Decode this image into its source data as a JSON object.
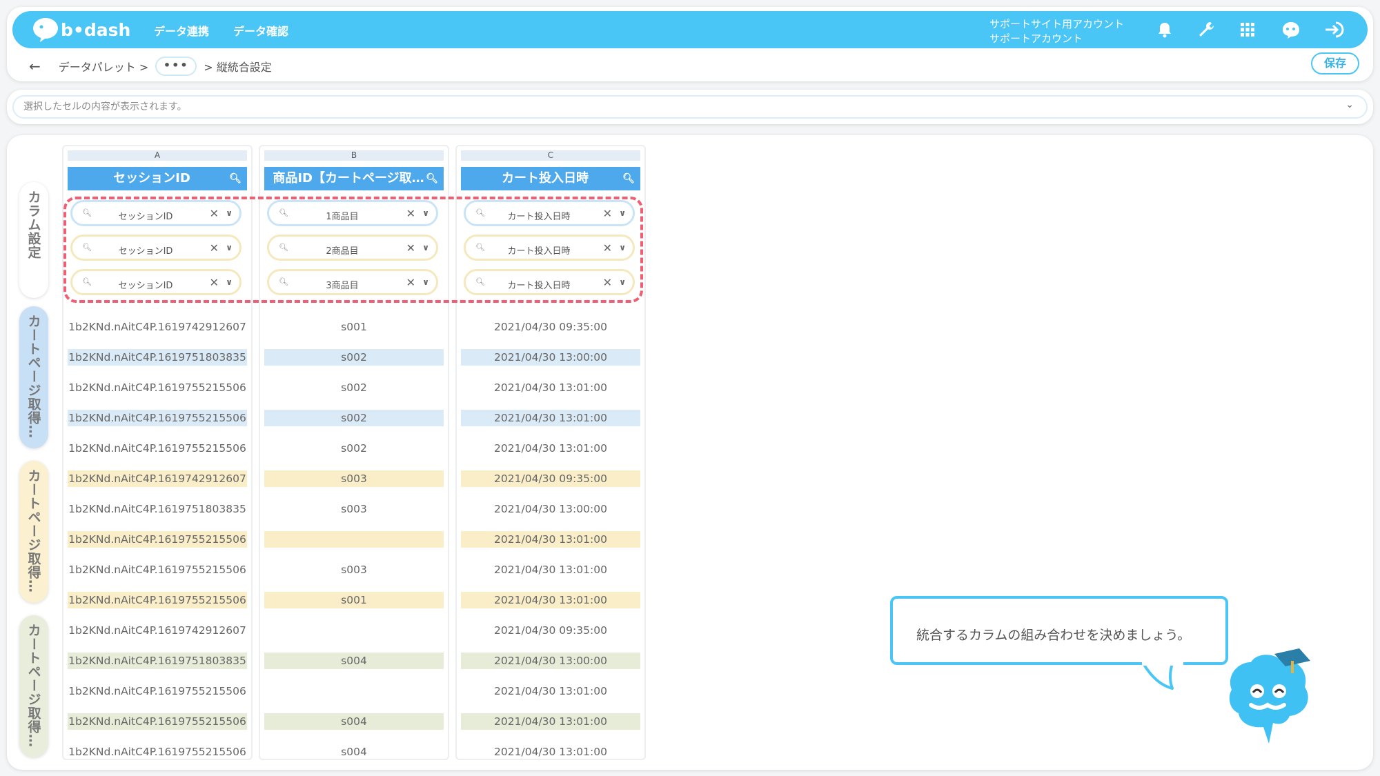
{
  "header": {
    "logo_text": "b•dash",
    "nav": [
      "データ連携",
      "データ確認"
    ],
    "account_line1": "サポートサイト用アカウント",
    "account_line2": "サポートアカウント",
    "icons": [
      "bell-icon",
      "wrench-icon",
      "grid-icon",
      "help-mascot-icon",
      "logout-icon"
    ],
    "accent_color": "#49c5f6"
  },
  "breadcrumb": {
    "back": "←",
    "item1": "データパレット >",
    "ellipsis": "•••",
    "current": "> 縦統合設定"
  },
  "save_label": "保存",
  "cell_bar": {
    "placeholder": "選択したセルの内容が表示されます。",
    "chevron": "⌄"
  },
  "side_tabs": [
    {
      "label": "カラム設定",
      "color": "#ffffff"
    },
    {
      "label": "カートページ取得…",
      "color": "#c8e0f6"
    },
    {
      "label": "カートページ取得…",
      "color": "#fbf0cf"
    },
    {
      "label": "カートページ取得…",
      "color": "#e9eedc"
    }
  ],
  "columns": [
    {
      "letter": "A",
      "header": "セッションID",
      "selectors": [
        "セッションID",
        "セッションID",
        "セッションID"
      ]
    },
    {
      "letter": "B",
      "header": "商品ID【カートページ取…",
      "selectors": [
        "1商品目",
        "2商品目",
        "3商品目"
      ]
    },
    {
      "letter": "C",
      "header": "カート投入日時",
      "selectors": [
        "カート投入日時",
        "カート投入日時",
        "カート投入日時"
      ]
    }
  ],
  "selector_border_colors": [
    "#c9e3f7",
    "#f5e8bd",
    "#f5e8bd"
  ],
  "rows": [
    {
      "a": "1b2KNd.nAitC4P.1619742912607",
      "b": "s001",
      "c": "2021/04/30 09:35:00",
      "hl": ""
    },
    {
      "a": "1b2KNd.nAitC4P.1619751803835",
      "b": "s002",
      "c": "2021/04/30 13:00:00",
      "hl": "blue"
    },
    {
      "a": "1b2KNd.nAitC4P.1619755215506",
      "b": "s002",
      "c": "2021/04/30 13:01:00",
      "hl": ""
    },
    {
      "a": "1b2KNd.nAitC4P.1619755215506",
      "b": "s002",
      "c": "2021/04/30 13:01:00",
      "hl": "blue"
    },
    {
      "a": "1b2KNd.nAitC4P.1619755215506",
      "b": "s002",
      "c": "2021/04/30 13:01:00",
      "hl": ""
    },
    {
      "a": "1b2KNd.nAitC4P.1619742912607",
      "b": "s003",
      "c": "2021/04/30 09:35:00",
      "hl": "yellow"
    },
    {
      "a": "1b2KNd.nAitC4P.1619751803835",
      "b": "s003",
      "c": "2021/04/30 13:00:00",
      "hl": ""
    },
    {
      "a": "1b2KNd.nAitC4P.1619755215506",
      "b": "",
      "c": "2021/04/30 13:01:00",
      "hl": "yellow"
    },
    {
      "a": "1b2KNd.nAitC4P.1619755215506",
      "b": "s003",
      "c": "2021/04/30 13:01:00",
      "hl": ""
    },
    {
      "a": "1b2KNd.nAitC4P.1619755215506",
      "b": "s001",
      "c": "2021/04/30 13:01:00",
      "hl": "yellow"
    },
    {
      "a": "1b2KNd.nAitC4P.1619742912607",
      "b": "",
      "c": "2021/04/30 09:35:00",
      "hl": ""
    },
    {
      "a": "1b2KNd.nAitC4P.1619751803835",
      "b": "s004",
      "c": "2021/04/30 13:00:00",
      "hl": "green"
    },
    {
      "a": "1b2KNd.nAitC4P.1619755215506",
      "b": "",
      "c": "2021/04/30 13:01:00",
      "hl": ""
    },
    {
      "a": "1b2KNd.nAitC4P.1619755215506",
      "b": "s004",
      "c": "2021/04/30 13:01:00",
      "hl": "green"
    },
    {
      "a": "1b2KNd.nAitC4P.1619755215506",
      "b": "s004",
      "c": "2021/04/30 13:01:00",
      "hl": ""
    }
  ],
  "tip": "統合するカラムの組み合わせを決めましょう。"
}
